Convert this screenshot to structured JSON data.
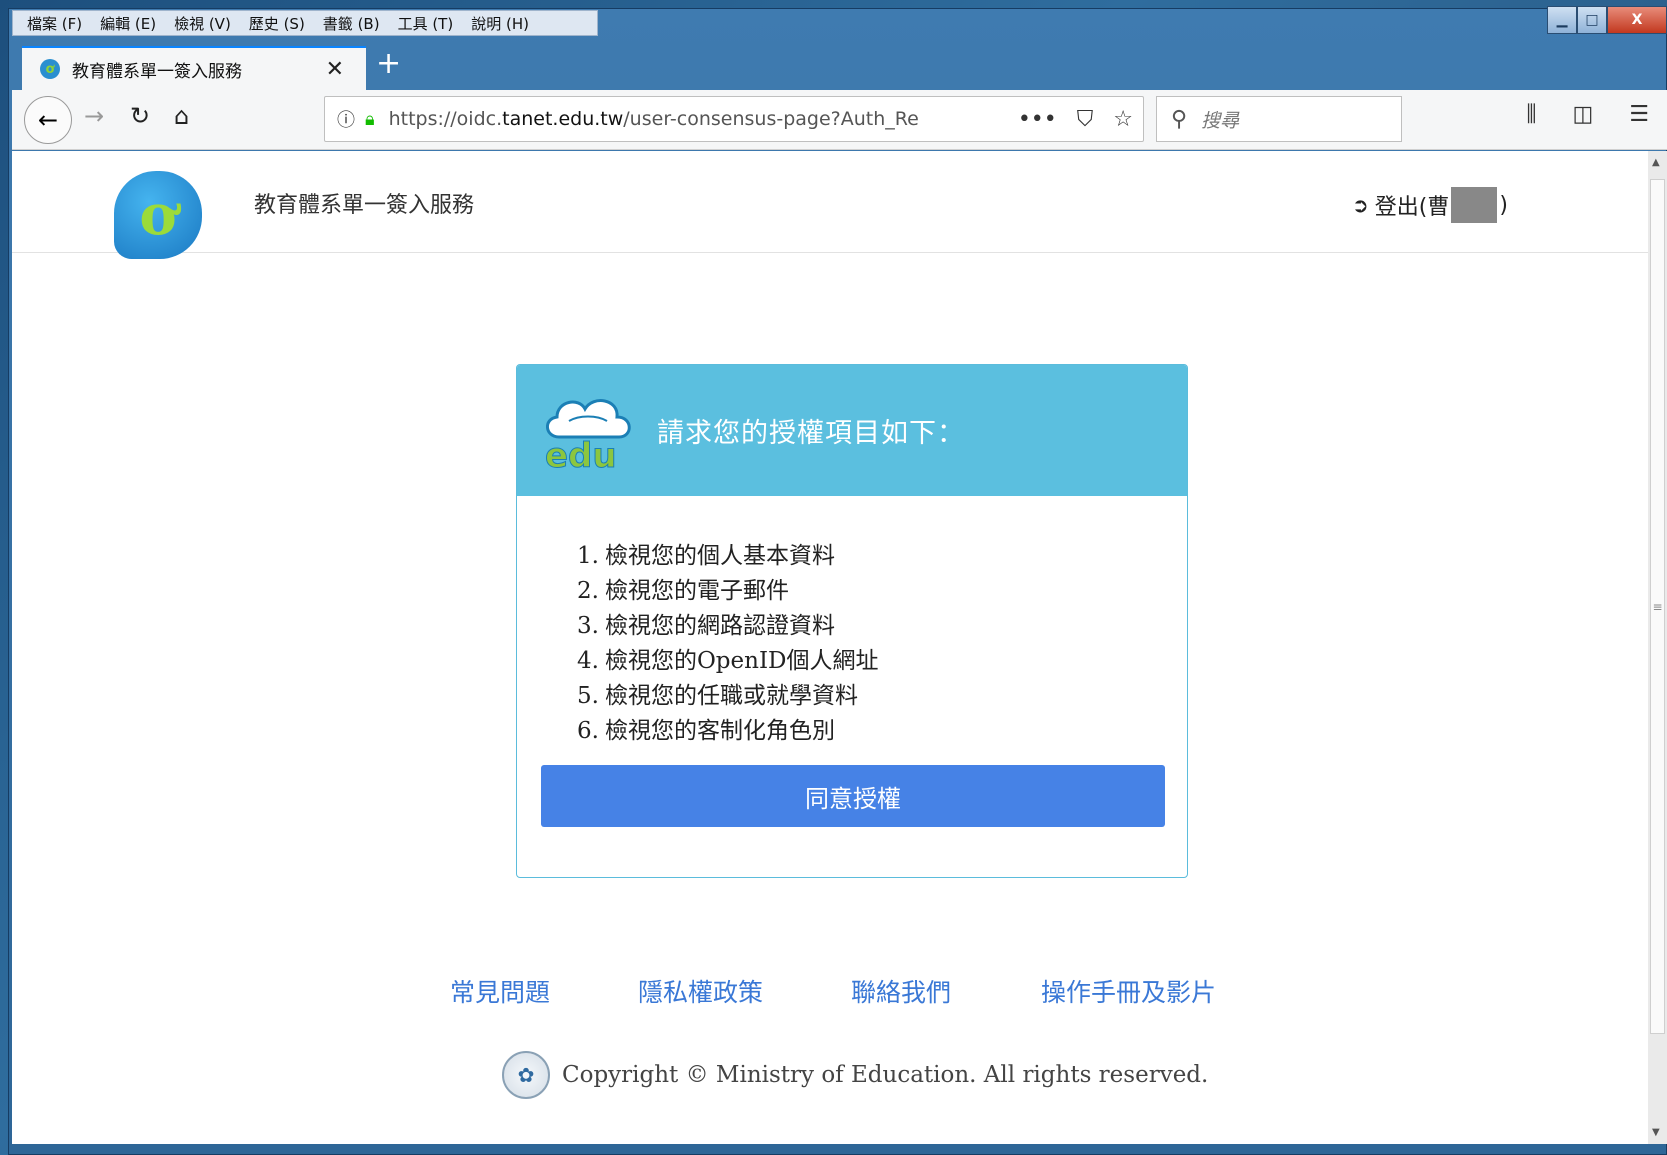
{
  "menubar": {
    "items": [
      "檔案 (F)",
      "編輯 (E)",
      "檢視 (V)",
      "歷史 (S)",
      "書籤 (B)",
      "工具 (T)",
      "說明 (H)"
    ]
  },
  "window_controls": {
    "minimize": "▁",
    "maximize": "□",
    "close": "X"
  },
  "tab": {
    "title": "教育體系單一簽入服務",
    "close": "✕",
    "new_tab": "+"
  },
  "navbar": {
    "url_prefix": "https://oidc.",
    "url_host": "tanet.edu.tw",
    "url_path": "/user-consensus-page?Auth_Re",
    "search_placeholder": "搜尋",
    "icons": [
      "back-icon",
      "forward-icon",
      "reload-icon",
      "home-icon",
      "info-icon",
      "lock-icon",
      "more-icon",
      "pocket-icon",
      "bookmark-star-icon",
      "search-icon",
      "library-icon",
      "sidebar-icon",
      "menu-icon"
    ]
  },
  "site": {
    "title": "教育體系單一簽入服務",
    "logout_prefix": "登出(曹",
    "logout_suffix": ")"
  },
  "card": {
    "heading": "請求您的授權項目如下：",
    "items": [
      {
        "num": "1.",
        "text": "檢視您的個人基本資料"
      },
      {
        "num": "2.",
        "text": "檢視您的電子郵件"
      },
      {
        "num": "3.",
        "text": "檢視您的網路認證資料"
      },
      {
        "num": "4.",
        "text": "檢視您的OpenID個人網址"
      },
      {
        "num": "5.",
        "text": "檢視您的任職或就學資料"
      },
      {
        "num": "6.",
        "text": "檢視您的客制化角色別"
      }
    ],
    "agree_button": "同意授權"
  },
  "footer": {
    "links": [
      "常見問題",
      "隱私權政策",
      "聯絡我們",
      "操作手冊及影片"
    ],
    "copyright": "Copyright © Ministry of Education. All rights reserved."
  },
  "colors": {
    "card_header": "#5bbfdf",
    "button": "#4682e6",
    "link": "#3a78d6"
  }
}
